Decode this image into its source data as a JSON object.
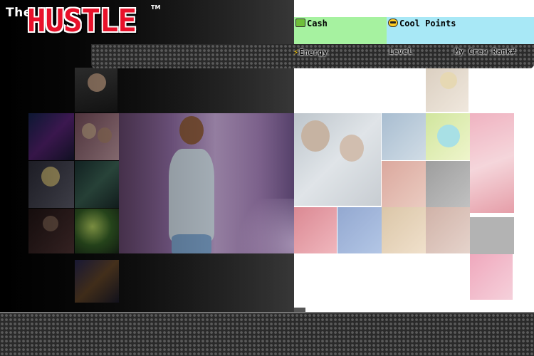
{
  "logo": {
    "prefix": "The",
    "title": "HUSTLE",
    "trademark": "TM"
  },
  "stats": {
    "cash_label": "Cash",
    "cash_icon": "cash-icon",
    "cool_points_label": "Cool Points",
    "cool_points_icon": "cool-face-icon",
    "energy_label": "Energy",
    "energy_icon": "lightning-icon",
    "level_label": "Level",
    "rank_label": "My Crew Rank#"
  },
  "colors": {
    "cash_bg": "#a6f2a0",
    "cool_points_bg": "#a8e8f6",
    "logo_red": "#e8112a"
  }
}
